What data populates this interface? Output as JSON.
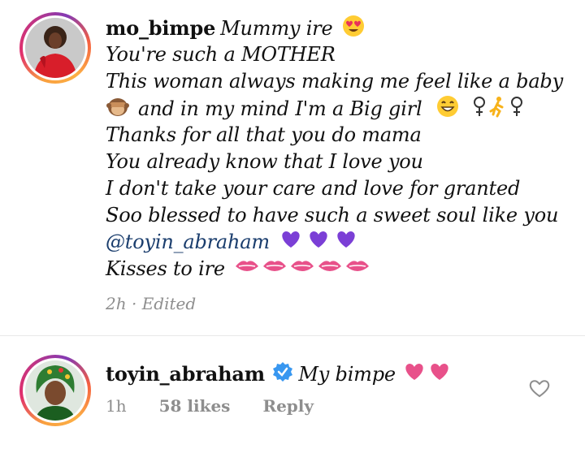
{
  "comments": [
    {
      "username": "mo_bimpe",
      "lines": [
        "Mummy ire",
        "You're such a MOTHER",
        "This woman always making me feel like a baby",
        "and in my mind I'm a Big girl",
        "Thanks for all that you do mama",
        "You already know that I love you",
        "I don't take your care and love for granted",
        "Soo blessed to have such a sweet soul like you",
        "@toyin_abraham",
        "Kisses to ire"
      ],
      "time": "2h",
      "separator": "·",
      "edited": "Edited"
    },
    {
      "username": "toyin_abraham",
      "text": "My bimpe",
      "time": "1h",
      "likes": "58 likes",
      "reply": "Reply"
    }
  ],
  "colors": {
    "mention": "#1a3d6d",
    "meta": "#8e8e8e",
    "verified": "#3897f0",
    "heart_pink": "#e8518a",
    "purple_heart": "#7b3fd6"
  },
  "icons": [
    "heart-eyes-emoji",
    "see-no-evil-emoji",
    "grin-emoji",
    "female-runner-emoji",
    "purple-heart-emoji",
    "kiss-mark-emoji",
    "pink-heart-emoji",
    "verified-badge-icon",
    "like-heart-icon"
  ]
}
